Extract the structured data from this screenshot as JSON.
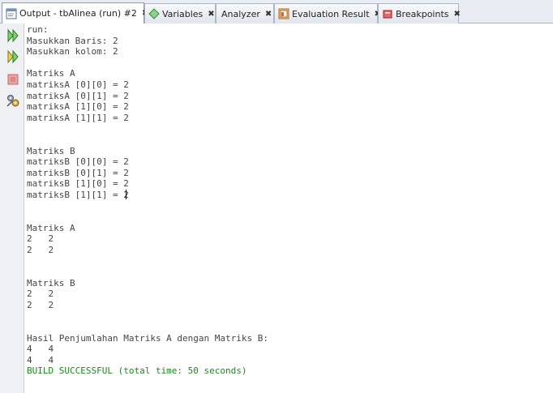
{
  "tabs": [
    {
      "label": "Output - tbAlinea (run) #2",
      "icon": "output-window-icon",
      "active": true
    },
    {
      "label": "Variables",
      "icon": "variables-diamond-icon",
      "active": false
    },
    {
      "label": "Analyzer",
      "icon": "",
      "active": false
    },
    {
      "label": "Evaluation Result",
      "icon": "evaluation-result-icon",
      "active": false
    },
    {
      "label": "Breakpoints",
      "icon": "breakpoint-icon",
      "active": false
    }
  ],
  "tab_close_glyph": "✖",
  "toolbar": [
    {
      "icon": "rerun-icon"
    },
    {
      "icon": "rerun-with-args-icon"
    },
    {
      "icon": "stop-icon"
    },
    {
      "icon": "settings-icon"
    }
  ],
  "output": {
    "lines": [
      "run:",
      "Masukkan Baris: 2",
      "Masukkan kolom: 2",
      "",
      "Matriks A",
      "matriksA [0][0] = 2",
      "matriksA [0][1] = 2",
      "matriksA [1][0] = 2",
      "matriksA [1][1] = 2",
      "",
      "",
      "Matriks B",
      "matriksB [0][0] = 2",
      "matriksB [0][1] = 2",
      "matriksB [1][0] = 2",
      "matriksB [1][1] = 2",
      "",
      "",
      "Matriks A",
      "2   2",
      "2   2",
      "",
      "",
      "Matriks B",
      "2   2",
      "2   2",
      "",
      "",
      "Hasil Penjumlahan Matriks A dengan Matriks B:",
      "4   4",
      "4   4",
      "BUILD SUCCESSFUL (total time: 50 seconds)"
    ]
  },
  "colors": {
    "success": "#1a8a1a",
    "text": "#444444",
    "accent": "#3a8a3a"
  }
}
